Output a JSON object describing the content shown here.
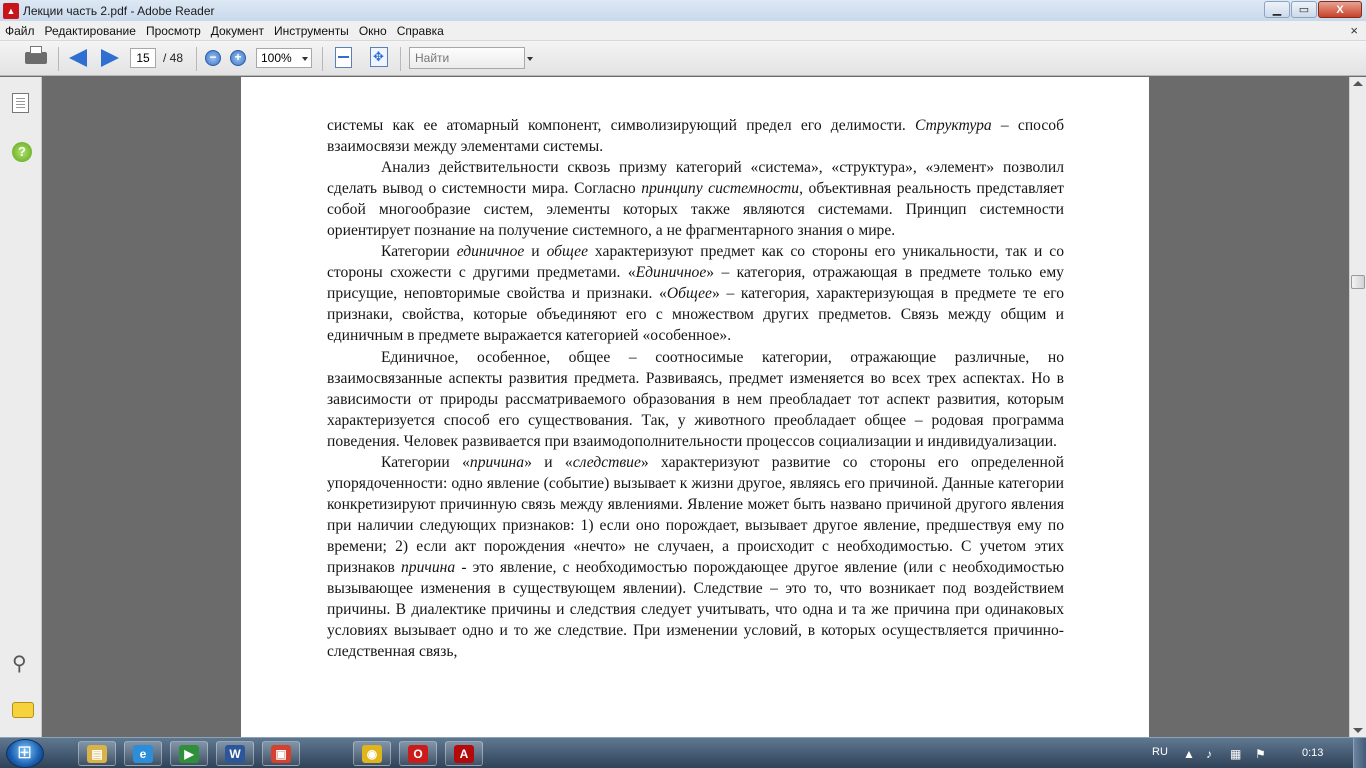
{
  "window": {
    "title": "Лекции часть 2.pdf - Adobe Reader",
    "controls": {
      "minimize": "▁",
      "maximize": "▭",
      "close": "X"
    }
  },
  "menu": {
    "items": [
      "Файл",
      "Редактирование",
      "Просмотр",
      "Документ",
      "Инструменты",
      "Окно",
      "Справка"
    ],
    "close_glyph": "×"
  },
  "toolbar": {
    "current_page": "15",
    "total_pages": "/ 48",
    "zoom_level": "100%",
    "zoom_out_glyph": "−",
    "zoom_in_glyph": "+",
    "search_placeholder": "Найти"
  },
  "document": {
    "paragraphs": [
      {
        "indent": false,
        "segments": [
          {
            "t": "системы как ее атомарный компонент, символизирующий предел его делимости. "
          },
          {
            "t": "Структура",
            "i": true
          },
          {
            "t": " – способ взаимосвязи между элементами системы."
          }
        ]
      },
      {
        "indent": true,
        "segments": [
          {
            "t": "Анализ действительности сквозь призму категорий «система», «структура», «элемент» позволил сделать вывод о системности мира. Согласно "
          },
          {
            "t": "принципу системности,",
            "i": true
          },
          {
            "t": " объективная реальность представляет собой многообразие систем, элементы которых также являются системами. Принцип системности ориентирует познание на получение системного, а не фрагментарного знания о мире."
          }
        ]
      },
      {
        "indent": true,
        "segments": [
          {
            "t": "Категории  "
          },
          {
            "t": "единичное",
            "i": true
          },
          {
            "t": " и "
          },
          {
            "t": "общее",
            "i": true
          },
          {
            "t": " характеризуют предмет как со стороны его уникальности, так и со стороны схожести с другими предметами. «"
          },
          {
            "t": "Единичное",
            "i": true
          },
          {
            "t": "» – категория, отражающая в предмете только ему присущие, неповторимые свойства и признаки. «"
          },
          {
            "t": "Общее",
            "i": true
          },
          {
            "t": "» – категория, характеризующая в предмете те его признаки, свойства, которые объединяют его с множеством других предметов. Связь между общим и единичным в предмете выражается категорией «особенное»."
          }
        ]
      },
      {
        "indent": true,
        "segments": [
          {
            "t": "Единичное, особенное, общее – соотносимые категории, отражающие различные, но взаимосвязанные аспекты развития предмета. Развиваясь, предмет изменяется во всех трех аспектах. Но в зависимости от природы рассматриваемого образования в нем преобладает тот аспект развития, которым характеризуется  способ его существования. Так, у животного преобладает общее – родовая программа поведения. Человек развивается при взаимодополнительности процессов социализации и индивидуализации."
          }
        ]
      },
      {
        "indent": true,
        "segments": [
          {
            "t": "Категории «"
          },
          {
            "t": "причина",
            "i": true
          },
          {
            "t": "» и «"
          },
          {
            "t": "следствие",
            "i": true
          },
          {
            "t": "» характеризуют развитие со стороны его определенной упорядоченности: одно явление (событие) вызывает  к жизни другое, являясь его причиной. Данные категории конкретизируют причинную связь между явлениями. Явление может быть названо причиной другого явления при наличии следующих признаков: 1) если оно порождает, вызывает другое явление, предшествуя ему по времени; 2) если акт порождения «нечто» не случаен, а происходит с необходимостью. С учетом этих признаков "
          },
          {
            "t": "причина",
            "i": true
          },
          {
            "t": "  - это явление, с необходимостью порождающее другое явление (или с необходимостью вызывающее изменения в существующем явлении). Следствие – это то, что возникает под воздействием  причины. В диалектике причины и следствия следует учитывать, что одна и та же причина при одинаковых условиях вызывает одно и то же следствие. При изменении условий, в которых осуществляется причинно-следственная связь,"
          }
        ]
      }
    ]
  },
  "taskbar": {
    "language": "RU",
    "clock": "0:13",
    "pinned": [
      {
        "name": "explorer",
        "glyph": "▤",
        "bg": "#d9b24a"
      },
      {
        "name": "internet-explorer",
        "glyph": "e",
        "bg": "#2c8ed8"
      },
      {
        "name": "media-player",
        "glyph": "▶",
        "bg": "#2f8f3a"
      },
      {
        "name": "word",
        "glyph": "W",
        "bg": "#2b579a"
      },
      {
        "name": "pdf-creator",
        "glyph": "▣",
        "bg": "#d4412f"
      },
      {
        "name": "chrome",
        "glyph": "◉",
        "bg": "#e0b51c"
      },
      {
        "name": "opera",
        "glyph": "O",
        "bg": "#cc1b1b"
      },
      {
        "name": "adobe-reader",
        "glyph": "A",
        "bg": "#b30b0b"
      }
    ]
  },
  "colors": {
    "accent": "#2f6fd0",
    "page_bg": "#ffffff",
    "workspace_bg": "#6b6b6b"
  }
}
